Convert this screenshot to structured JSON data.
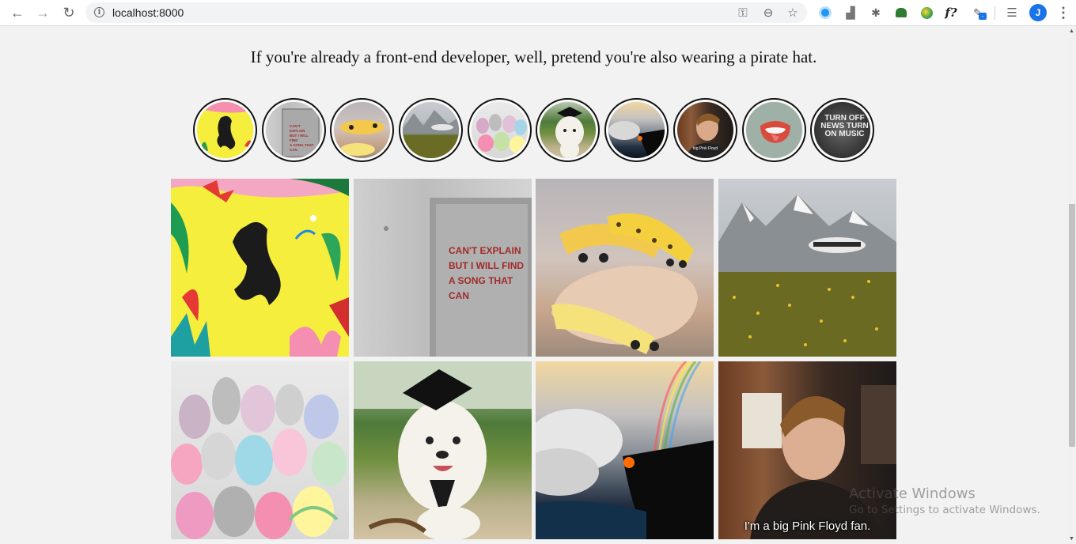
{
  "browser": {
    "url": "localhost:8000",
    "profile_initial": "J",
    "extension_badge": "-",
    "icons": {
      "back": "arrow-left-icon",
      "forward": "arrow-right-icon",
      "reload": "reload-icon",
      "info": "info-icon",
      "key": "key-icon",
      "zoom": "zoom-icon",
      "bookmark": "star-icon",
      "menu": "kebab-menu-icon"
    },
    "extension_f": "f?"
  },
  "page": {
    "headline": "If you're already a front-end developer, well, pretend you're also wearing a pirate hat.",
    "thumbnails": [
      {
        "name": "matisse-figure"
      },
      {
        "name": "cant-explain-wall"
      },
      {
        "name": "banana-cats"
      },
      {
        "name": "mountain-house"
      },
      {
        "name": "pebble-creatures"
      },
      {
        "name": "graduate-dog"
      },
      {
        "name": "lava-rainbow"
      },
      {
        "name": "bowie-pink-floyd"
      },
      {
        "name": "rolling-stones-lips"
      },
      {
        "name": "turn-off-news"
      }
    ],
    "grid_images": [
      {
        "name": "matisse-figure"
      },
      {
        "name": "cant-explain-wall",
        "text": "CAN'T EXPLAIN BUT I WILL FIND A SONG THAT CAN"
      },
      {
        "name": "banana-cats"
      },
      {
        "name": "mountain-house"
      },
      {
        "name": "pebble-creatures"
      },
      {
        "name": "graduate-dog"
      },
      {
        "name": "lava-rainbow"
      },
      {
        "name": "bowie-pink-floyd",
        "caption": "I'm a big Pink Floyd fan."
      }
    ],
    "news_text": "TURN OFF NEWS TURN ON MUSIC",
    "thumb_caption": "big Pink Floyd"
  },
  "os": {
    "watermark_title": "Activate Windows",
    "watermark_sub": "Go to Settings to activate Windows."
  }
}
